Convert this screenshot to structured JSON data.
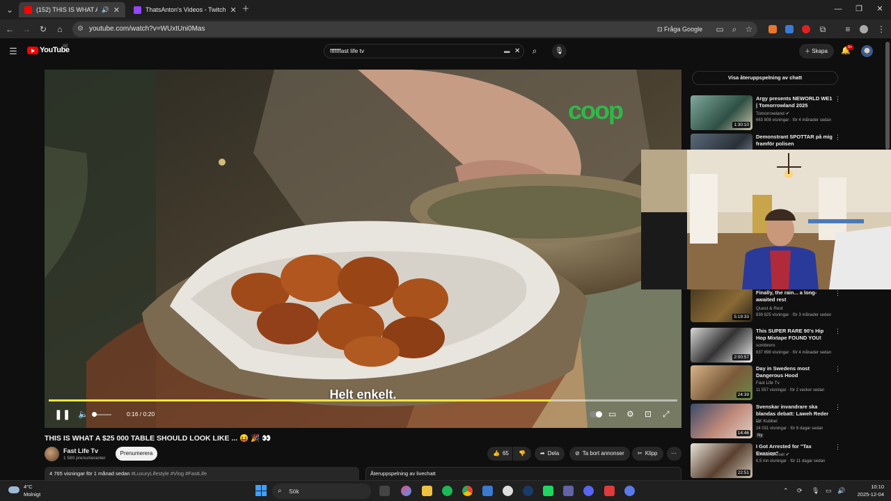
{
  "browser": {
    "tabs": [
      {
        "label": "(152) THIS IS WHAT A $25",
        "active": true
      },
      {
        "label": "ThatsAnton's Videos - Twitch",
        "active": false
      }
    ],
    "url": "youtube.com/watch?v=WUxtUni0Mas",
    "ask_google_label": "Fråga Google"
  },
  "youtube": {
    "wordmark": "YouTube",
    "region": "SE",
    "search_value": "fffffffast life  tv",
    "create_label": "Skapa",
    "notification_count": "9+"
  },
  "player": {
    "subtitle": "Helt enkelt.",
    "time": "0:16 / 0:20",
    "progress_fraction": 0.8,
    "overlay_logo_text": "coop"
  },
  "video": {
    "title": "THIS IS WHAT A $25 000 TABLE SHOULD LOOK LIKE ... 😝 🎉 👀",
    "channel_name": "Fast Life Tv",
    "channel_subs": "1 580 prenumeranter",
    "subscribe_label": "Prenumerera",
    "like_count": "65",
    "share_label": "Dela",
    "remove_ads_label": "Ta bort annonser",
    "clip_label": "Klipp",
    "views_date": "4 765 visningar  för 1 månad sedan",
    "hashtags": "#LuxuryLifestyle #Vlog #FastLife",
    "chat_replay_header": "Återuppspelning av livechatt"
  },
  "sidebar": {
    "replay_chat_button": "Visa återuppspelning av chatt",
    "recommendations": [
      {
        "title": "Argy presents NEWORLD WE1 | Tomorrowland 2025",
        "channel": "Tomorrowland",
        "meta": "663 808 visningar · för 4 månader sedan",
        "duration": "1:30:10",
        "verified": true
      },
      {
        "title": "Demonstrant SPOTTAR på mig framför polisen",
        "channel": "",
        "meta": "",
        "duration": "",
        "verified": false
      },
      {
        "title": "Finally, the rain... a long-awaited rest",
        "channel": "Quest & Rest",
        "meta": "839 825 visningar · för 3 månader sedan",
        "duration": "5:19:33",
        "verified": false
      },
      {
        "title": "This SUPER RARE 90's Hip Hop Mixtape FOUND YOU!",
        "channel": "sombrero",
        "meta": "637 898 visningar · för 4 månader sedan",
        "duration": "2:00:57",
        "verified": false
      },
      {
        "title": "Day in Swedens most Dangerous Hood",
        "channel": "Fast Life Tv",
        "meta": "11 557 visningar · för 2 veckor sedan",
        "duration": "24:39",
        "verified": false
      },
      {
        "title": "Svenskar invandrare ska blandas debatt: Laweh Reder ...",
        "channel": "PK Kubbel",
        "meta": "24 031 visningar · för 6 dagar sedan",
        "duration": "14:46",
        "badge": "Ny",
        "verified": false
      },
      {
        "title": "I Got Arrested for \"Tax Evasion\"",
        "channel": "WhistlinDiesel",
        "meta": "6,5 mn visningar · för 11 dagar sedan",
        "duration": "22:51",
        "verified": true
      }
    ]
  },
  "taskbar": {
    "temperature": "4°C",
    "weather": "Molnigt",
    "search_label": "Sök",
    "time": "10:10",
    "date": "2025-12-04"
  },
  "colors": {
    "youtube_red": "#ff0000",
    "progress_yellow": "#f2e63c",
    "coop_green": "#2fb84a"
  }
}
